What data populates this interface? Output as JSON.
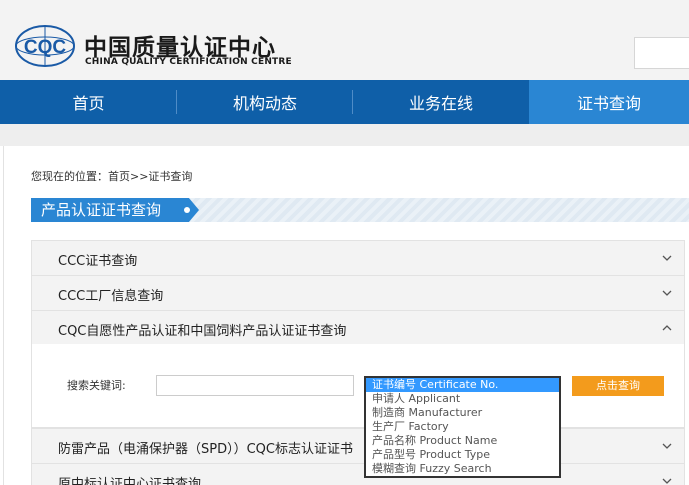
{
  "brand": {
    "logo_text": "CQC",
    "name_cn": "中国质量认证中心",
    "name_en": "CHINA QUALITY CERTIFICATION CENTRE"
  },
  "nav": {
    "items": [
      {
        "label": "首页"
      },
      {
        "label": "机构动态"
      },
      {
        "label": "业务在线"
      },
      {
        "label": "证书查询"
      }
    ],
    "active": "证书查询"
  },
  "breadcrumb": "您现在的位置：首页>>证书查询",
  "section_title": "产品认证证书查询",
  "accordion": [
    {
      "label": "CCC证书查询",
      "expanded": false,
      "icon": "chevron-down-icon"
    },
    {
      "label": "CCC工厂信息查询",
      "expanded": false,
      "icon": "chevron-down-icon"
    },
    {
      "label": "CQC自愿性产品认证和中国饲料产品认证证书查询",
      "expanded": true,
      "icon": "chevron-up-icon"
    },
    {
      "label": "防雷产品（电涌保护器（SPD））CQC标志认证证书",
      "expanded": false,
      "icon": "chevron-down-icon"
    },
    {
      "label": "原中标认证中心证书查询",
      "expanded": false,
      "icon": "chevron-down-icon"
    }
  ],
  "search": {
    "label": "搜索关键词:",
    "value": "",
    "button_label": "点击查询",
    "options": [
      {
        "label": "证书编号 Certificate No.",
        "selected": true
      },
      {
        "label": "申请人 Applicant",
        "selected": false
      },
      {
        "label": "制造商 Manufacturer",
        "selected": false
      },
      {
        "label": "生产厂 Factory",
        "selected": false
      },
      {
        "label": "产品名称 Product Name",
        "selected": false
      },
      {
        "label": "产品型号 Product Type",
        "selected": false
      },
      {
        "label": "模糊查询 Fuzzy Search",
        "selected": false
      }
    ]
  },
  "colors": {
    "nav_bg": "#0f5fa8",
    "nav_active": "#2a86d3",
    "button": "#f39b1c",
    "selected_option": "#3399ff"
  }
}
